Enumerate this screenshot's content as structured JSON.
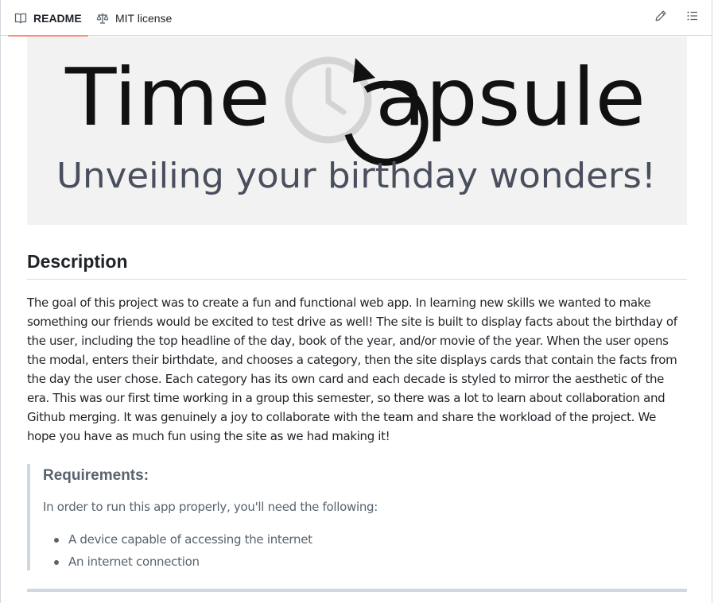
{
  "tabs": [
    {
      "label": "README",
      "icon": "book-icon",
      "active": true
    },
    {
      "label": "MIT license",
      "icon": "law-scale-icon",
      "active": false
    }
  ],
  "toolbar": {
    "edit_icon": "pencil-icon",
    "outline_icon": "list-unordered-icon"
  },
  "banner": {
    "logo_left": "Time",
    "logo_right": "apsule",
    "tagline": "Unveiling your birthday wonders!"
  },
  "description": {
    "heading": "Description",
    "body": "The goal of this project was to create a fun and functional web app. In learning new skills we wanted to make something our friends would be excited to test drive as well! The site is built to display facts about the birthday of the user, including the top headline of the day, book of the year, and/or movie of the year. When the user opens the modal, enters their birthdate, and chooses a category, then the site displays cards that contain the facts from the day the user chose. Each category has its own card and each decade is styled to mirror the aesthetic of the era. This was our first time working in a group this semester, so there was a lot to learn about collaboration and Github merging. It was genuinely a joy to collaborate with the team and share the workload of the project. We hope you have as much fun using the site as we had making it!"
  },
  "requirements": {
    "heading": "Requirements:",
    "intro": "In order to run this app properly, you'll need the following:",
    "items": [
      "A device capable of accessing the internet",
      "An internet connection"
    ]
  },
  "colors": {
    "accent_underline": "#fd8c73",
    "border": "#d0d7de",
    "banner_bg": "#f2f2f2",
    "tagline": "#4a4f5e",
    "muted_text": "#59636e"
  }
}
